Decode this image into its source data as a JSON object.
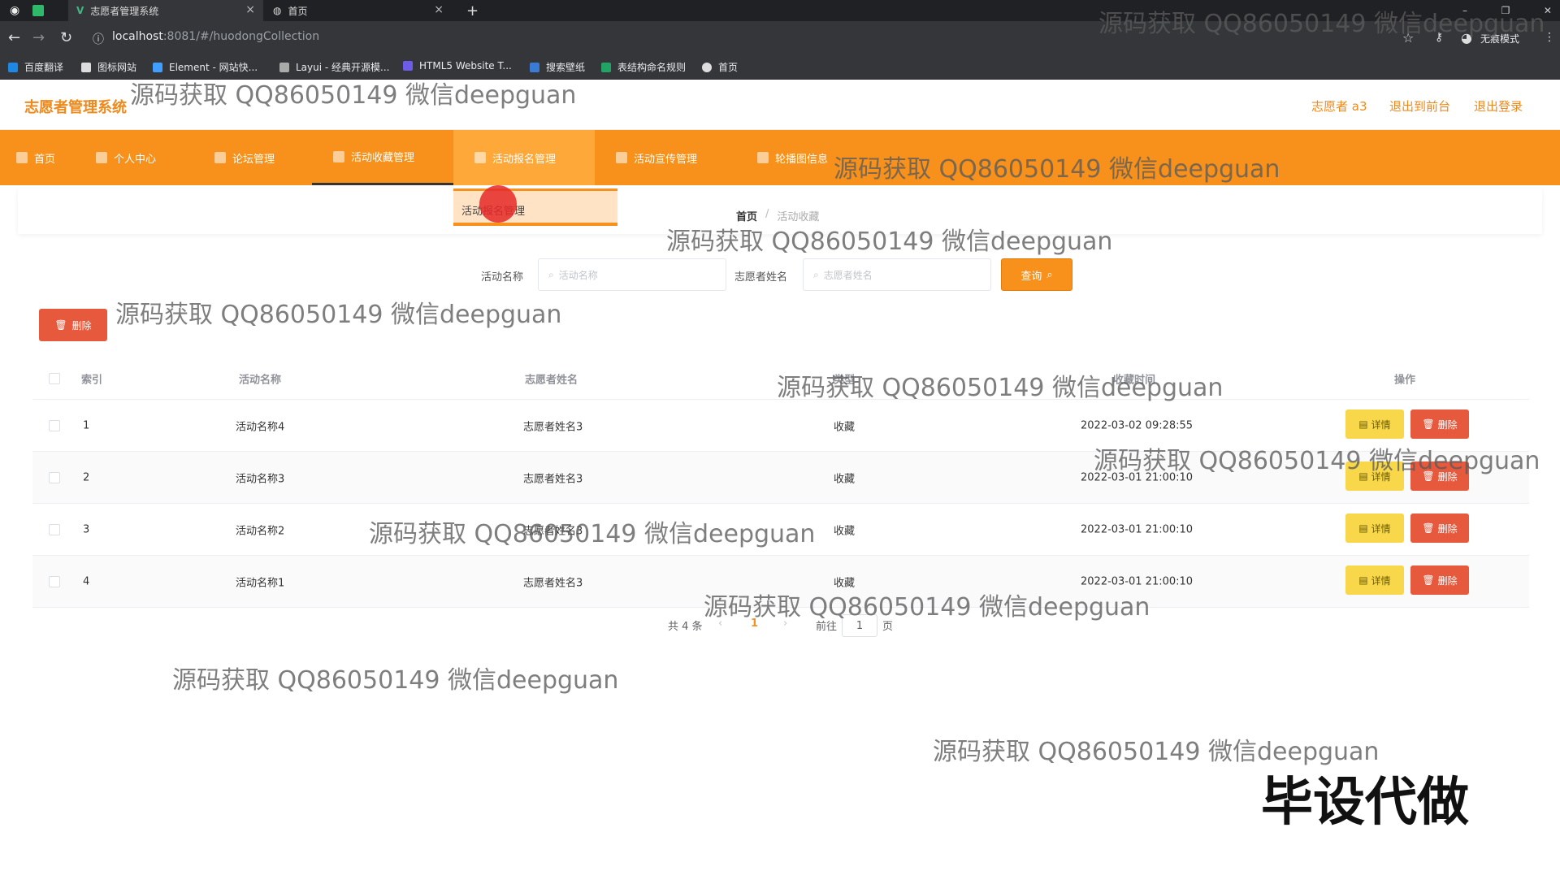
{
  "browser": {
    "tabs": [
      {
        "title": "志愿者管理系统",
        "close": "×"
      },
      {
        "title": "首页",
        "close": "×"
      }
    ],
    "new_tab": "+",
    "url_host": "localhost",
    "url_rest": ":8081/#/huodongCollection",
    "incognito_label": "无痕模式",
    "bookmarks": [
      "百度翻译",
      "图标网站",
      "Element - 网站快...",
      "Layui - 经典开源模...",
      "HTML5 Website T...",
      "搜索壁纸",
      "表结构命名规则",
      "首页"
    ]
  },
  "app": {
    "title": "志愿者管理系统",
    "user_label": "志愿者 a3",
    "back_front": "退出到前台",
    "logout": "退出登录"
  },
  "nav": {
    "items": [
      "首页",
      "个人中心",
      "论坛管理",
      "活动收藏管理",
      "活动报名管理",
      "活动宣传管理",
      "轮播图信息"
    ],
    "dropdown_item": "活动报名管理"
  },
  "breadcrumb": {
    "home": "首页",
    "sep": "/",
    "current": "活动收藏"
  },
  "search": {
    "activity_label": "活动名称",
    "activity_placeholder": "活动名称",
    "volunteer_label": "志愿者姓名",
    "volunteer_placeholder": "志愿者姓名",
    "query_button": "查询"
  },
  "toolbar": {
    "delete_label": "删除"
  },
  "table": {
    "headers": [
      "索引",
      "活动名称",
      "志愿者姓名",
      "类型",
      "收藏时间",
      "操作"
    ],
    "rows": [
      {
        "index": "1",
        "name": "活动名称4",
        "volunteer": "志愿者姓名3",
        "type": "收藏",
        "time": "2022-03-02 09:28:55"
      },
      {
        "index": "2",
        "name": "活动名称3",
        "volunteer": "志愿者姓名3",
        "type": "收藏",
        "time": "2022-03-01 21:00:10"
      },
      {
        "index": "3",
        "name": "活动名称2",
        "volunteer": "志愿者姓名3",
        "type": "收藏",
        "time": "2022-03-01 21:00:10"
      },
      {
        "index": "4",
        "name": "活动名称1",
        "volunteer": "志愿者姓名3",
        "type": "收藏",
        "time": "2022-03-01 21:00:10"
      }
    ],
    "detail_label": "详情",
    "delete_label": "删除"
  },
  "pagination": {
    "total": "共 4 条",
    "prev": "‹",
    "current": "1",
    "next": "›",
    "goto": "前往",
    "page_value": "1",
    "page_suffix": "页"
  },
  "watermark": "源码获取 QQ86050149 微信deepguan",
  "promo": "毕设代做",
  "colors": {
    "accent": "#f7911b",
    "danger": "#e7593c",
    "detail": "#f8d84a"
  }
}
